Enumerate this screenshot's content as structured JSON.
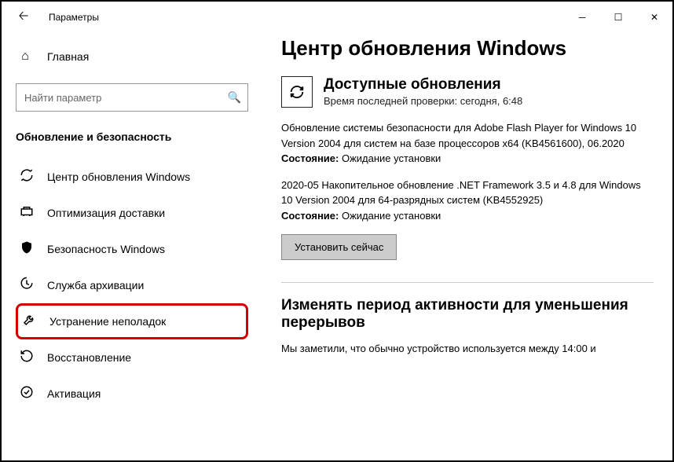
{
  "window": {
    "app_title": "Параметры"
  },
  "sidebar": {
    "home_label": "Главная",
    "search_placeholder": "Найти параметр",
    "category_label": "Обновление и безопасность",
    "items": [
      {
        "label": "Центр обновления Windows"
      },
      {
        "label": "Оптимизация доставки"
      },
      {
        "label": "Безопасность Windows"
      },
      {
        "label": "Служба архивации"
      },
      {
        "label": "Устранение неполадок"
      },
      {
        "label": "Восстановление"
      },
      {
        "label": "Активация"
      }
    ]
  },
  "main": {
    "title": "Центр обновления Windows",
    "available_title": "Доступные обновления",
    "available_subtitle": "Время последней проверки: сегодня, 6:48",
    "updates": [
      {
        "desc": "Обновление системы безопасности для Adobe Flash Player for Windows 10 Version 2004 для систем на базе процессоров x64 (KB4561600), 06.2020",
        "status_label": "Состояние:",
        "status_value": "Ожидание установки"
      },
      {
        "desc": "2020-05 Накопительное обновление .NET Framework 3.5 и 4.8 для Windows 10 Version 2004 для 64-разрядных систем (KB4552925)",
        "status_label": "Состояние:",
        "status_value": "Ожидание установки"
      }
    ],
    "install_button": "Установить сейчас",
    "activity_title": "Изменять период активности для уменьшения перерывов",
    "activity_text": "Мы заметили, что обычно устройство используется между 14:00 и"
  }
}
